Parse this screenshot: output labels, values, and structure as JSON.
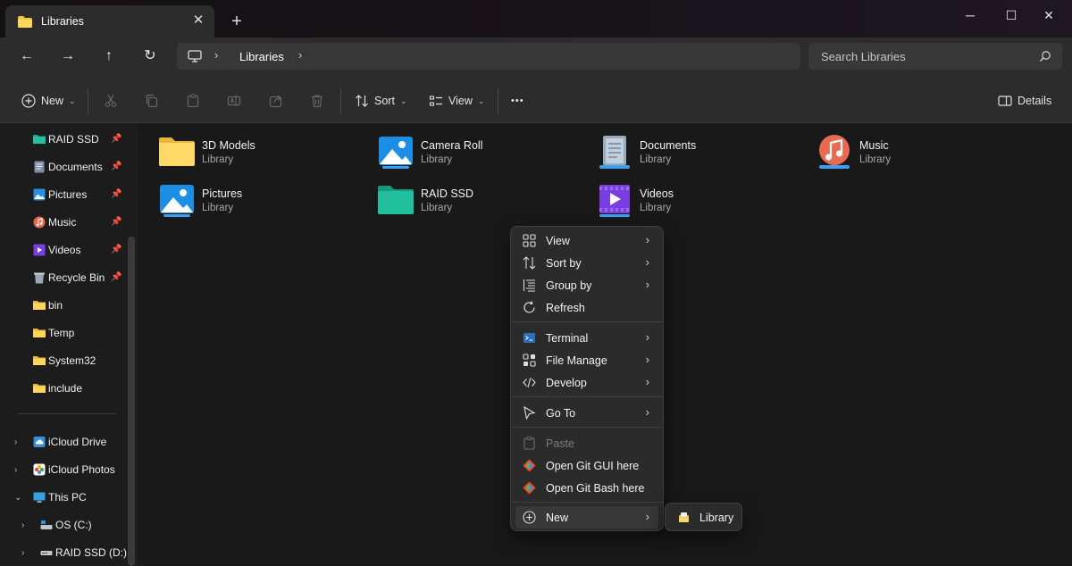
{
  "window": {
    "tab_title": "Libraries",
    "new_tab": "+",
    "minimize": "─",
    "maximize": "☐",
    "close": "✕"
  },
  "nav": {
    "back": "←",
    "forward": "→",
    "up": "↑",
    "refresh": "↻",
    "breadcrumb": "Libraries",
    "search_placeholder": "Search Libraries"
  },
  "commands": {
    "new": "New",
    "sort": "Sort",
    "view": "View",
    "more": "•••",
    "details": "Details"
  },
  "sidebar": {
    "pinned": [
      {
        "label": "RAID SSD",
        "icon": "drive-green-icon"
      },
      {
        "label": "Documents",
        "icon": "documents-icon"
      },
      {
        "label": "Pictures",
        "icon": "pictures-icon"
      },
      {
        "label": "Music",
        "icon": "music-icon"
      },
      {
        "label": "Videos",
        "icon": "videos-icon"
      },
      {
        "label": "Recycle Bin",
        "icon": "recycle-bin-icon"
      },
      {
        "label": "bin",
        "icon": "folder-icon"
      },
      {
        "label": "Temp",
        "icon": "folder-icon"
      },
      {
        "label": "System32",
        "icon": "folder-icon"
      },
      {
        "label": "include",
        "icon": "folder-icon"
      }
    ],
    "tree": [
      {
        "label": "iCloud Drive",
        "chevron": "›"
      },
      {
        "label": "iCloud Photos",
        "chevron": "›"
      },
      {
        "label": "This PC",
        "chevron": "⌄"
      },
      {
        "label": "OS (C:)",
        "chevron": "›"
      },
      {
        "label": "RAID SSD (D:)",
        "chevron": "›"
      }
    ]
  },
  "libraries": [
    {
      "name": "3D Models",
      "type": "Library"
    },
    {
      "name": "Camera Roll",
      "type": "Library"
    },
    {
      "name": "Documents",
      "type": "Library"
    },
    {
      "name": "Music",
      "type": "Library"
    },
    {
      "name": "Pictures",
      "type": "Library"
    },
    {
      "name": "RAID SSD",
      "type": "Library"
    },
    {
      "name": "Videos",
      "type": "Library"
    }
  ],
  "context_menu": {
    "items": [
      {
        "label": "View"
      },
      {
        "label": "Sort by"
      },
      {
        "label": "Group by"
      },
      {
        "label": "Refresh"
      },
      {
        "label": "Terminal"
      },
      {
        "label": "File Manage"
      },
      {
        "label": "Develop"
      },
      {
        "label": "Go To"
      },
      {
        "label": "Paste"
      },
      {
        "label": "Open Git GUI here"
      },
      {
        "label": "Open Git Bash here"
      },
      {
        "label": "New"
      }
    ],
    "arrow": "›",
    "submenu_item": "Library"
  }
}
